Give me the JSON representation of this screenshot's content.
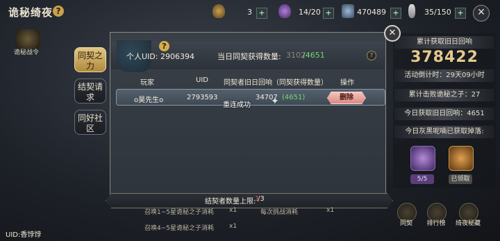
{
  "header": {
    "title": "诡秘绮夜",
    "help_label": "?",
    "resources": [
      {
        "value": "3"
      },
      {
        "value": "14/20"
      },
      {
        "value": "470489"
      },
      {
        "value": "35/150"
      }
    ],
    "plus_label": "+",
    "close_label": "✕"
  },
  "left": {
    "emblem_label": "诡秘战令",
    "tabs": [
      {
        "label": "同契之力",
        "active": true
      },
      {
        "label": "结契请求",
        "active": false
      },
      {
        "label": "同好社区",
        "active": false
      }
    ]
  },
  "panel": {
    "help_label": "?",
    "uid_text": "个人UID: 2906394",
    "daily_label": "当日同契获得数量:",
    "daily_used": "3102",
    "daily_max": "/4651",
    "columns": [
      "玩家",
      "UID",
      "同契者旧日回响（同契获得数量）",
      "操作"
    ],
    "rows": [
      {
        "player": "o昊先生o",
        "uid": "2793593",
        "echo": "34707",
        "gain": "(4651)",
        "action": "删除"
      }
    ],
    "toast": "重连成功",
    "footer_label": "结契者数量上限:",
    "footer_cur": "1",
    "footer_max": "/3",
    "close_label": "✕"
  },
  "right": {
    "total_label": "累计获取旧日回响",
    "total_value": "378422",
    "countdown": "活动倒计时：29天09小时",
    "defeated": "累计击败诡秘之子：27",
    "today_got": "今日获取旧日回响：4651",
    "today_drop": "今日灰黑呢喃已获取掉落:",
    "items": [
      {
        "badge": "5/5",
        "color": "#8a5fc0"
      },
      {
        "badge": "已领取",
        "color": "#c47a2a"
      }
    ]
  },
  "bottom": {
    "rows": [
      {
        "text": "召唤1~5星诡秘之子消耗",
        "qty": "x1"
      },
      {
        "text": "召唤4~5星诡秘之子消耗",
        "qty": "x1"
      }
    ],
    "mid_text": "每次挑战消耗",
    "mid_qty": "x1",
    "buttons": [
      "同契",
      "排行榜",
      "绮夜秘藏"
    ],
    "uid": "UID:香饽饽"
  }
}
